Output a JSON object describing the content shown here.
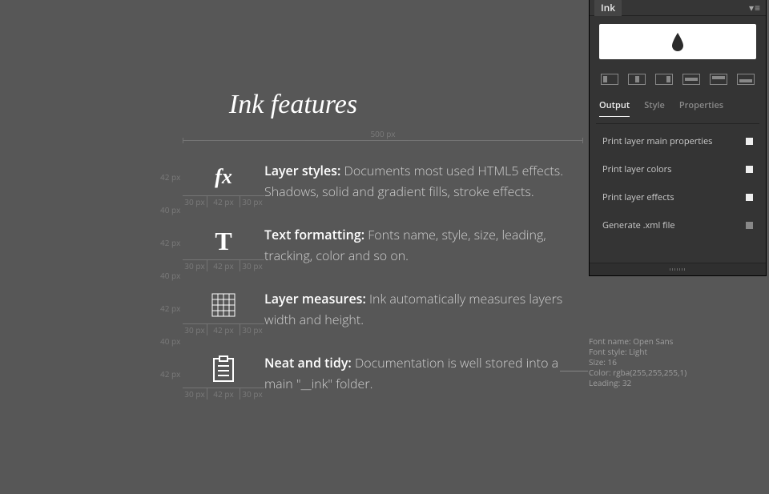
{
  "title": "Ink features",
  "measurements": {
    "top_width": "500 px",
    "row_h": "42 px",
    "gap_h": "40 px",
    "col_a": "30 px",
    "col_b": "42 px",
    "col_c": "30 px"
  },
  "features": [
    {
      "label": "Layer styles:",
      "desc": " Documents most used HTML5 effects. Shadows, solid and gradient fills, stroke effects."
    },
    {
      "label": "Text formatting:",
      "desc": " Fonts name, style, size, leading, tracking, color and so on."
    },
    {
      "label": "Layer measures:",
      "desc": " Ink automatically measures layers width and height."
    },
    {
      "label": "Neat and tidy:",
      "desc": "  Documentation is well stored into a main \"__ink\" folder."
    }
  ],
  "font_note": {
    "l1": "Font name: Open Sans",
    "l2": "Font style: Light",
    "l3": "Size: 16",
    "l4": "Color: rgba(255,255,255,1)",
    "l5": "Leading: 32"
  },
  "panel": {
    "title": "Ink",
    "tabs": {
      "output": "Output",
      "style": "Style",
      "properties": "Properties"
    },
    "items": [
      "Print layer main properties",
      "Print layer colors",
      "Print layer effects",
      "Generate .xml file"
    ]
  },
  "chart_data": null
}
